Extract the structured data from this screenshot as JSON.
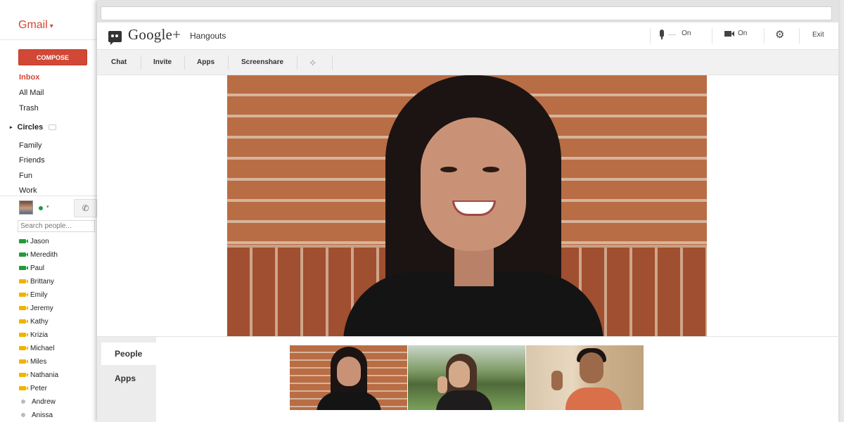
{
  "gmail": {
    "brand": "Gmail",
    "compose_label": "COMPOSE",
    "nav": [
      "Inbox",
      "All Mail",
      "Trash"
    ],
    "circles_label": "Circles",
    "circles": [
      "Family",
      "Friends",
      "Fun",
      "Work"
    ],
    "search_placeholder": "Search people...",
    "contacts": [
      {
        "name": "Jason",
        "status": "video-green"
      },
      {
        "name": "Meredith",
        "status": "video-green"
      },
      {
        "name": "Paul",
        "status": "video-green"
      },
      {
        "name": "Brittany",
        "status": "video-yellow"
      },
      {
        "name": "Emily",
        "status": "video-yellow"
      },
      {
        "name": "Jeremy",
        "status": "video-yellow"
      },
      {
        "name": "Kathy",
        "status": "video-yellow"
      },
      {
        "name": "Krizia",
        "status": "video-yellow"
      },
      {
        "name": "Michael",
        "status": "video-yellow"
      },
      {
        "name": "Miles",
        "status": "video-yellow"
      },
      {
        "name": "Nathania",
        "status": "video-yellow"
      },
      {
        "name": "Peter",
        "status": "video-yellow"
      },
      {
        "name": "Andrew",
        "status": "offline"
      },
      {
        "name": "Anissa",
        "status": "offline"
      }
    ]
  },
  "hangout": {
    "logo": "Google+",
    "app_name": "Hangouts",
    "mic_level": "....",
    "mic_state": "On",
    "camera_state": "On",
    "exit_label": "Exit",
    "toolbar": [
      "Chat",
      "Invite",
      "Apps",
      "Screenshare"
    ],
    "side_tabs": [
      "People",
      "Apps"
    ]
  },
  "colors": {
    "gmail_red": "#d14836",
    "online_green": "#1e9c3c",
    "idle_yellow": "#f0b400"
  }
}
